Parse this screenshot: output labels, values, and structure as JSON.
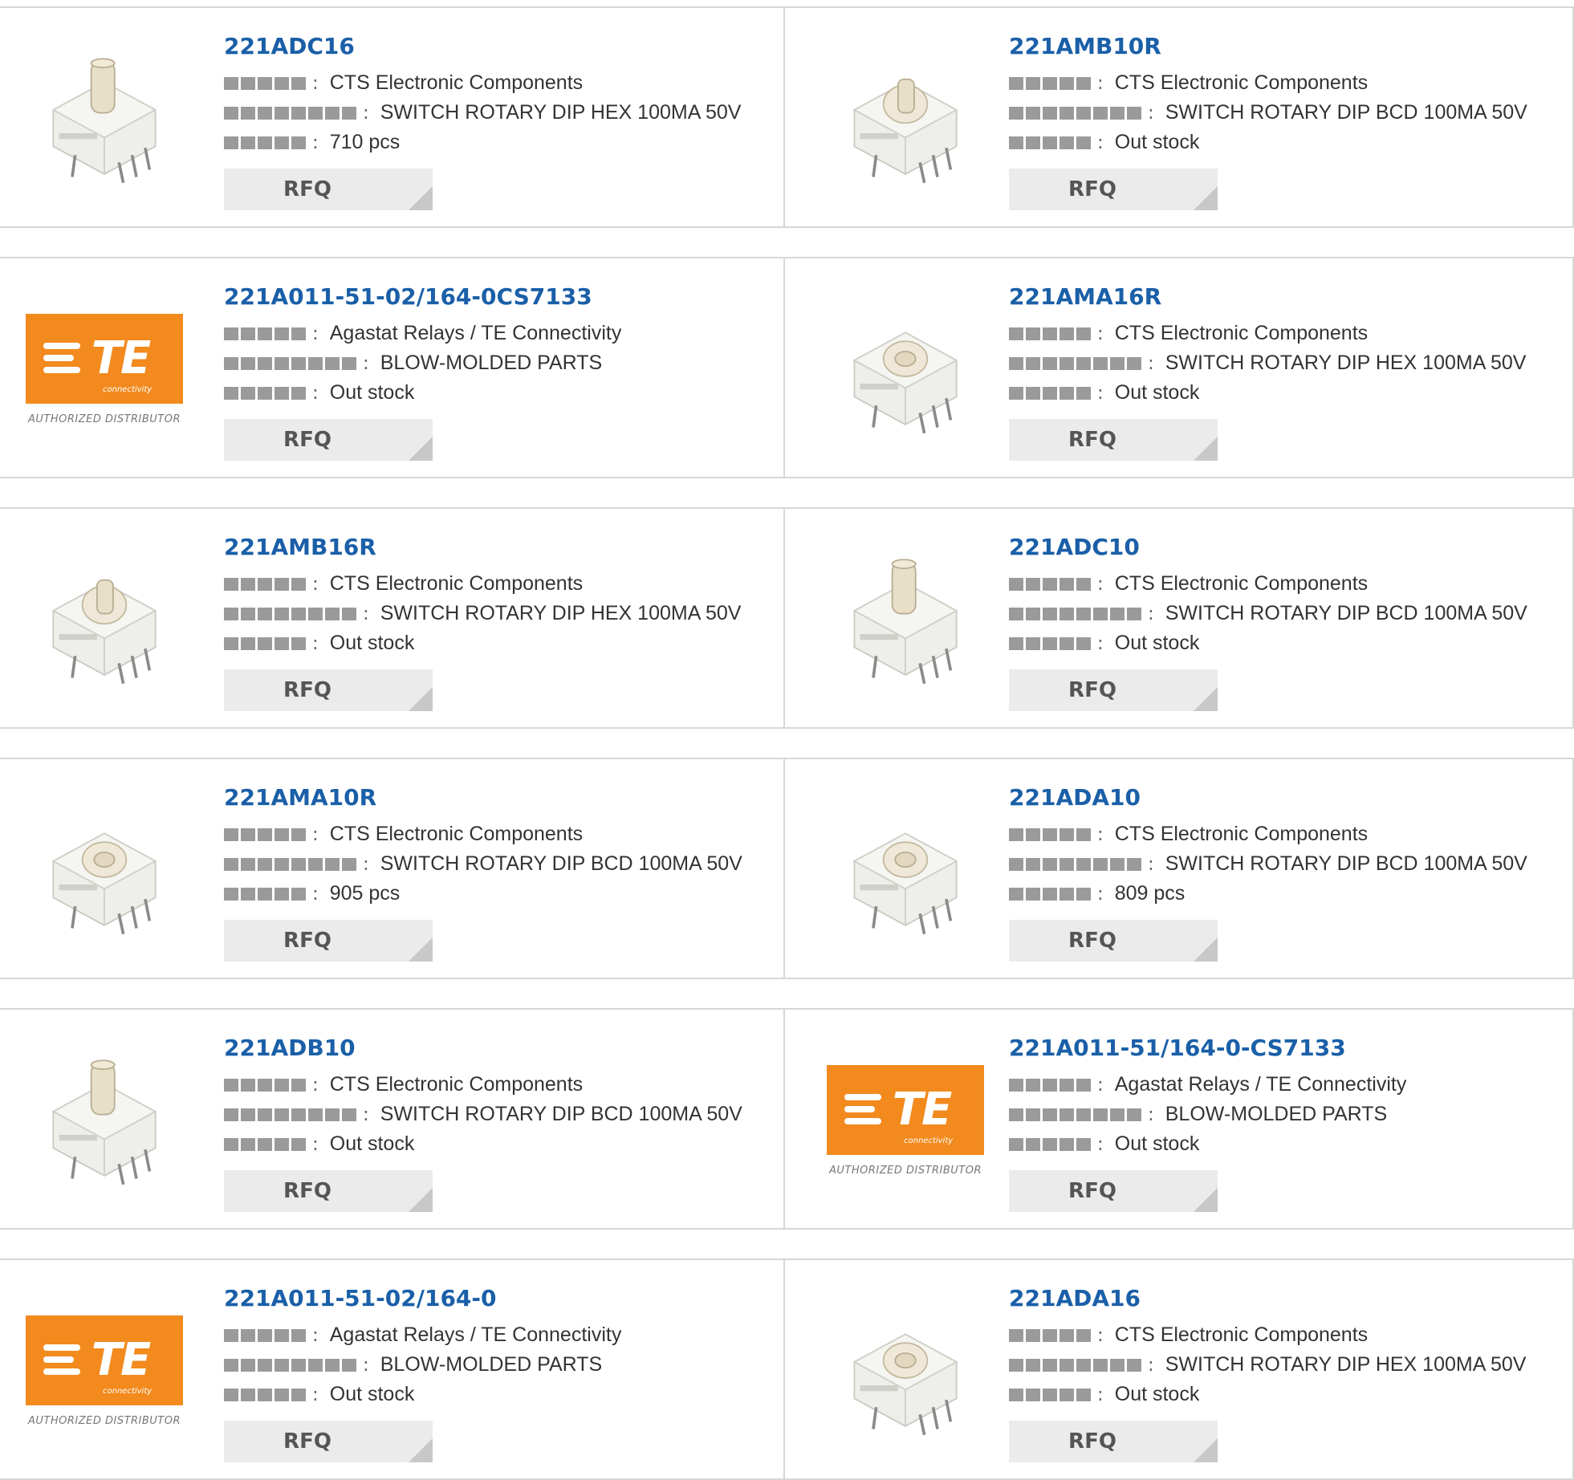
{
  "labels": {
    "rfq": "RFQ",
    "colon": ":"
  },
  "colors": {
    "link": "#1a5fa8",
    "te_orange": "#f28a1e",
    "mask": "#9a9a9a"
  },
  "te_logo": {
    "letters": "TE",
    "sub": "connectivity",
    "tagline": "AUTHORIZED DISTRIBUTOR"
  },
  "products": [
    {
      "part": "221ADC16",
      "manufacturer": "CTS Electronic Components",
      "description": "SWITCH ROTARY DIP HEX 100MA 50V",
      "stock": "710 pcs",
      "image": "rotary-dip-switch-tall-knob"
    },
    {
      "part": "221AMB10R",
      "manufacturer": "CTS Electronic Components",
      "description": "SWITCH ROTARY DIP BCD 100MA 50V",
      "stock": "Out stock",
      "image": "rotary-dip-switch-knob"
    },
    {
      "part": "221A011-51-02/164-0CS7133",
      "manufacturer": "Agastat Relays / TE Connectivity",
      "description": "BLOW-MOLDED PARTS",
      "stock": "Out stock",
      "image": "te-logo"
    },
    {
      "part": "221AMA16R",
      "manufacturer": "CTS Electronic Components",
      "description": "SWITCH ROTARY DIP HEX 100MA 50V",
      "stock": "Out stock",
      "image": "rotary-dip-switch-flush"
    },
    {
      "part": "221AMB16R",
      "manufacturer": "CTS Electronic Components",
      "description": "SWITCH ROTARY DIP HEX 100MA 50V",
      "stock": "Out stock",
      "image": "rotary-dip-switch-knob"
    },
    {
      "part": "221ADC10",
      "manufacturer": "CTS Electronic Components",
      "description": "SWITCH ROTARY DIP BCD 100MA 50V",
      "stock": "Out stock",
      "image": "rotary-dip-switch-tall-knob"
    },
    {
      "part": "221AMA10R",
      "manufacturer": "CTS Electronic Components",
      "description": "SWITCH ROTARY DIP BCD 100MA 50V",
      "stock": "905 pcs",
      "image": "rotary-dip-switch-flush"
    },
    {
      "part": "221ADA10",
      "manufacturer": "CTS Electronic Components",
      "description": "SWITCH ROTARY DIP BCD 100MA 50V",
      "stock": "809 pcs",
      "image": "rotary-dip-switch-flush"
    },
    {
      "part": "221ADB10",
      "manufacturer": "CTS Electronic Components",
      "description": "SWITCH ROTARY DIP BCD 100MA 50V",
      "stock": "Out stock",
      "image": "rotary-dip-switch-tall-knob"
    },
    {
      "part": "221A011-51/164-0-CS7133",
      "manufacturer": "Agastat Relays / TE Connectivity",
      "description": "BLOW-MOLDED PARTS",
      "stock": "Out stock",
      "image": "te-logo"
    },
    {
      "part": "221A011-51-02/164-0",
      "manufacturer": "Agastat Relays / TE Connectivity",
      "description": "BLOW-MOLDED PARTS",
      "stock": "Out stock",
      "image": "te-logo"
    },
    {
      "part": "221ADA16",
      "manufacturer": "CTS Electronic Components",
      "description": "SWITCH ROTARY DIP HEX 100MA 50V",
      "stock": "Out stock",
      "image": "rotary-dip-switch-flush"
    }
  ]
}
